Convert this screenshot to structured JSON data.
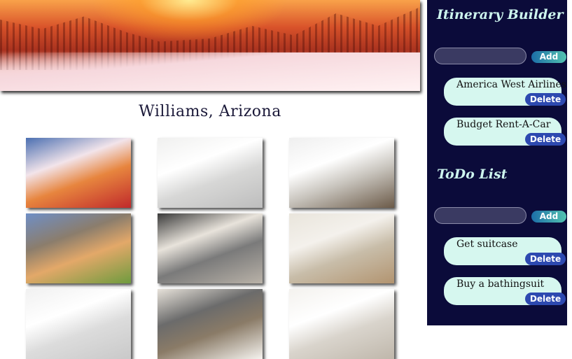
{
  "hero": {
    "image": "snowy-forest-sunset"
  },
  "city": {
    "title": "Williams, Arizona"
  },
  "gallery": {
    "photos": [
      {
        "name": "mountain-sunset-photo",
        "colors": [
          "#4b6fb1",
          "#e7853e",
          "#c0292b",
          "#f2e4ea"
        ]
      },
      {
        "name": "bathroom-photo",
        "colors": [
          "#f0f0ef",
          "#d7d7d6",
          "#bdbdbd",
          "#ffffff"
        ]
      },
      {
        "name": "kitchen-photo",
        "colors": [
          "#efefef",
          "#c8c4bd",
          "#6b5a48",
          "#ffffff"
        ]
      },
      {
        "name": "cabin-exterior-photo",
        "colors": [
          "#6f8fc6",
          "#e3a869",
          "#6e9b3e",
          "#8b7d6c"
        ]
      },
      {
        "name": "living-room-photo",
        "colors": [
          "#3a3a3a",
          "#7a7a7a",
          "#b9b2a8",
          "#e8e3db"
        ]
      },
      {
        "name": "bedroom-photo",
        "colors": [
          "#e9e5dc",
          "#c8bda9",
          "#b29470",
          "#f4f1ec"
        ]
      },
      {
        "name": "white-bedroom-photo",
        "colors": [
          "#f1f1f1",
          "#dcdcdc",
          "#c9c9c9",
          "#ffffff"
        ]
      },
      {
        "name": "open-living-photo",
        "colors": [
          "#e7e2da",
          "#8a7b67",
          "#f5f3ef",
          "#6b6b6b"
        ]
      },
      {
        "name": "window-room-photo",
        "colors": [
          "#f4f2ee",
          "#d9d4cc",
          "#bfb7ab",
          "#ffffff"
        ]
      }
    ]
  },
  "itinerary": {
    "title": "Itinerary Builder",
    "input_placeholder": "",
    "add_label": "Add",
    "items": [
      {
        "label": "America West Airlines",
        "delete_label": "Delete"
      },
      {
        "label": "Budget Rent-A-Car",
        "delete_label": "Delete"
      }
    ]
  },
  "todo": {
    "title": "ToDo List",
    "input_placeholder": "",
    "add_label": "Add",
    "items": [
      {
        "label": "Get suitcase",
        "delete_label": "Delete"
      },
      {
        "label": "Buy a bathingsuit",
        "delete_label": "Delete"
      }
    ]
  },
  "colors": {
    "sidebar_bg": "#0b0b3a",
    "item_bg": "#d6f7ef",
    "delete_bg": "#2d49b0",
    "title_color": "#cdf5ee"
  }
}
